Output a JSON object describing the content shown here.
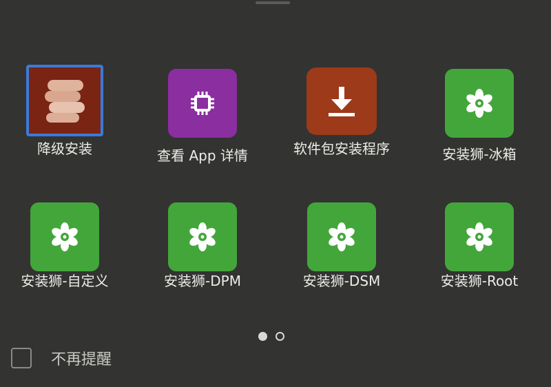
{
  "apps": [
    {
      "label": "降级安装",
      "icon": "layers-icon",
      "color": "#7a2413",
      "selected": true
    },
    {
      "label": "查看 App 详情",
      "icon": "chip-icon",
      "color": "#8a2ea0"
    },
    {
      "label": "软件包安装程序",
      "icon": "download-icon",
      "color": "#9c3a1a"
    },
    {
      "label": "安装狮-冰箱",
      "icon": "flower-icon",
      "color": "#43a63a"
    },
    {
      "label": "安装狮-自定义",
      "icon": "flower-icon",
      "color": "#43a63a"
    },
    {
      "label": "安装狮-DPM",
      "icon": "flower-icon",
      "color": "#43a63a"
    },
    {
      "label": "安装狮-DSM",
      "icon": "flower-icon",
      "color": "#43a63a"
    },
    {
      "label": "安装狮-Root",
      "icon": "flower-icon",
      "color": "#43a63a"
    }
  ],
  "pager": {
    "pages": 2,
    "current": 1
  },
  "footer": {
    "checkbox_label": "不再提醒",
    "checked": false
  }
}
